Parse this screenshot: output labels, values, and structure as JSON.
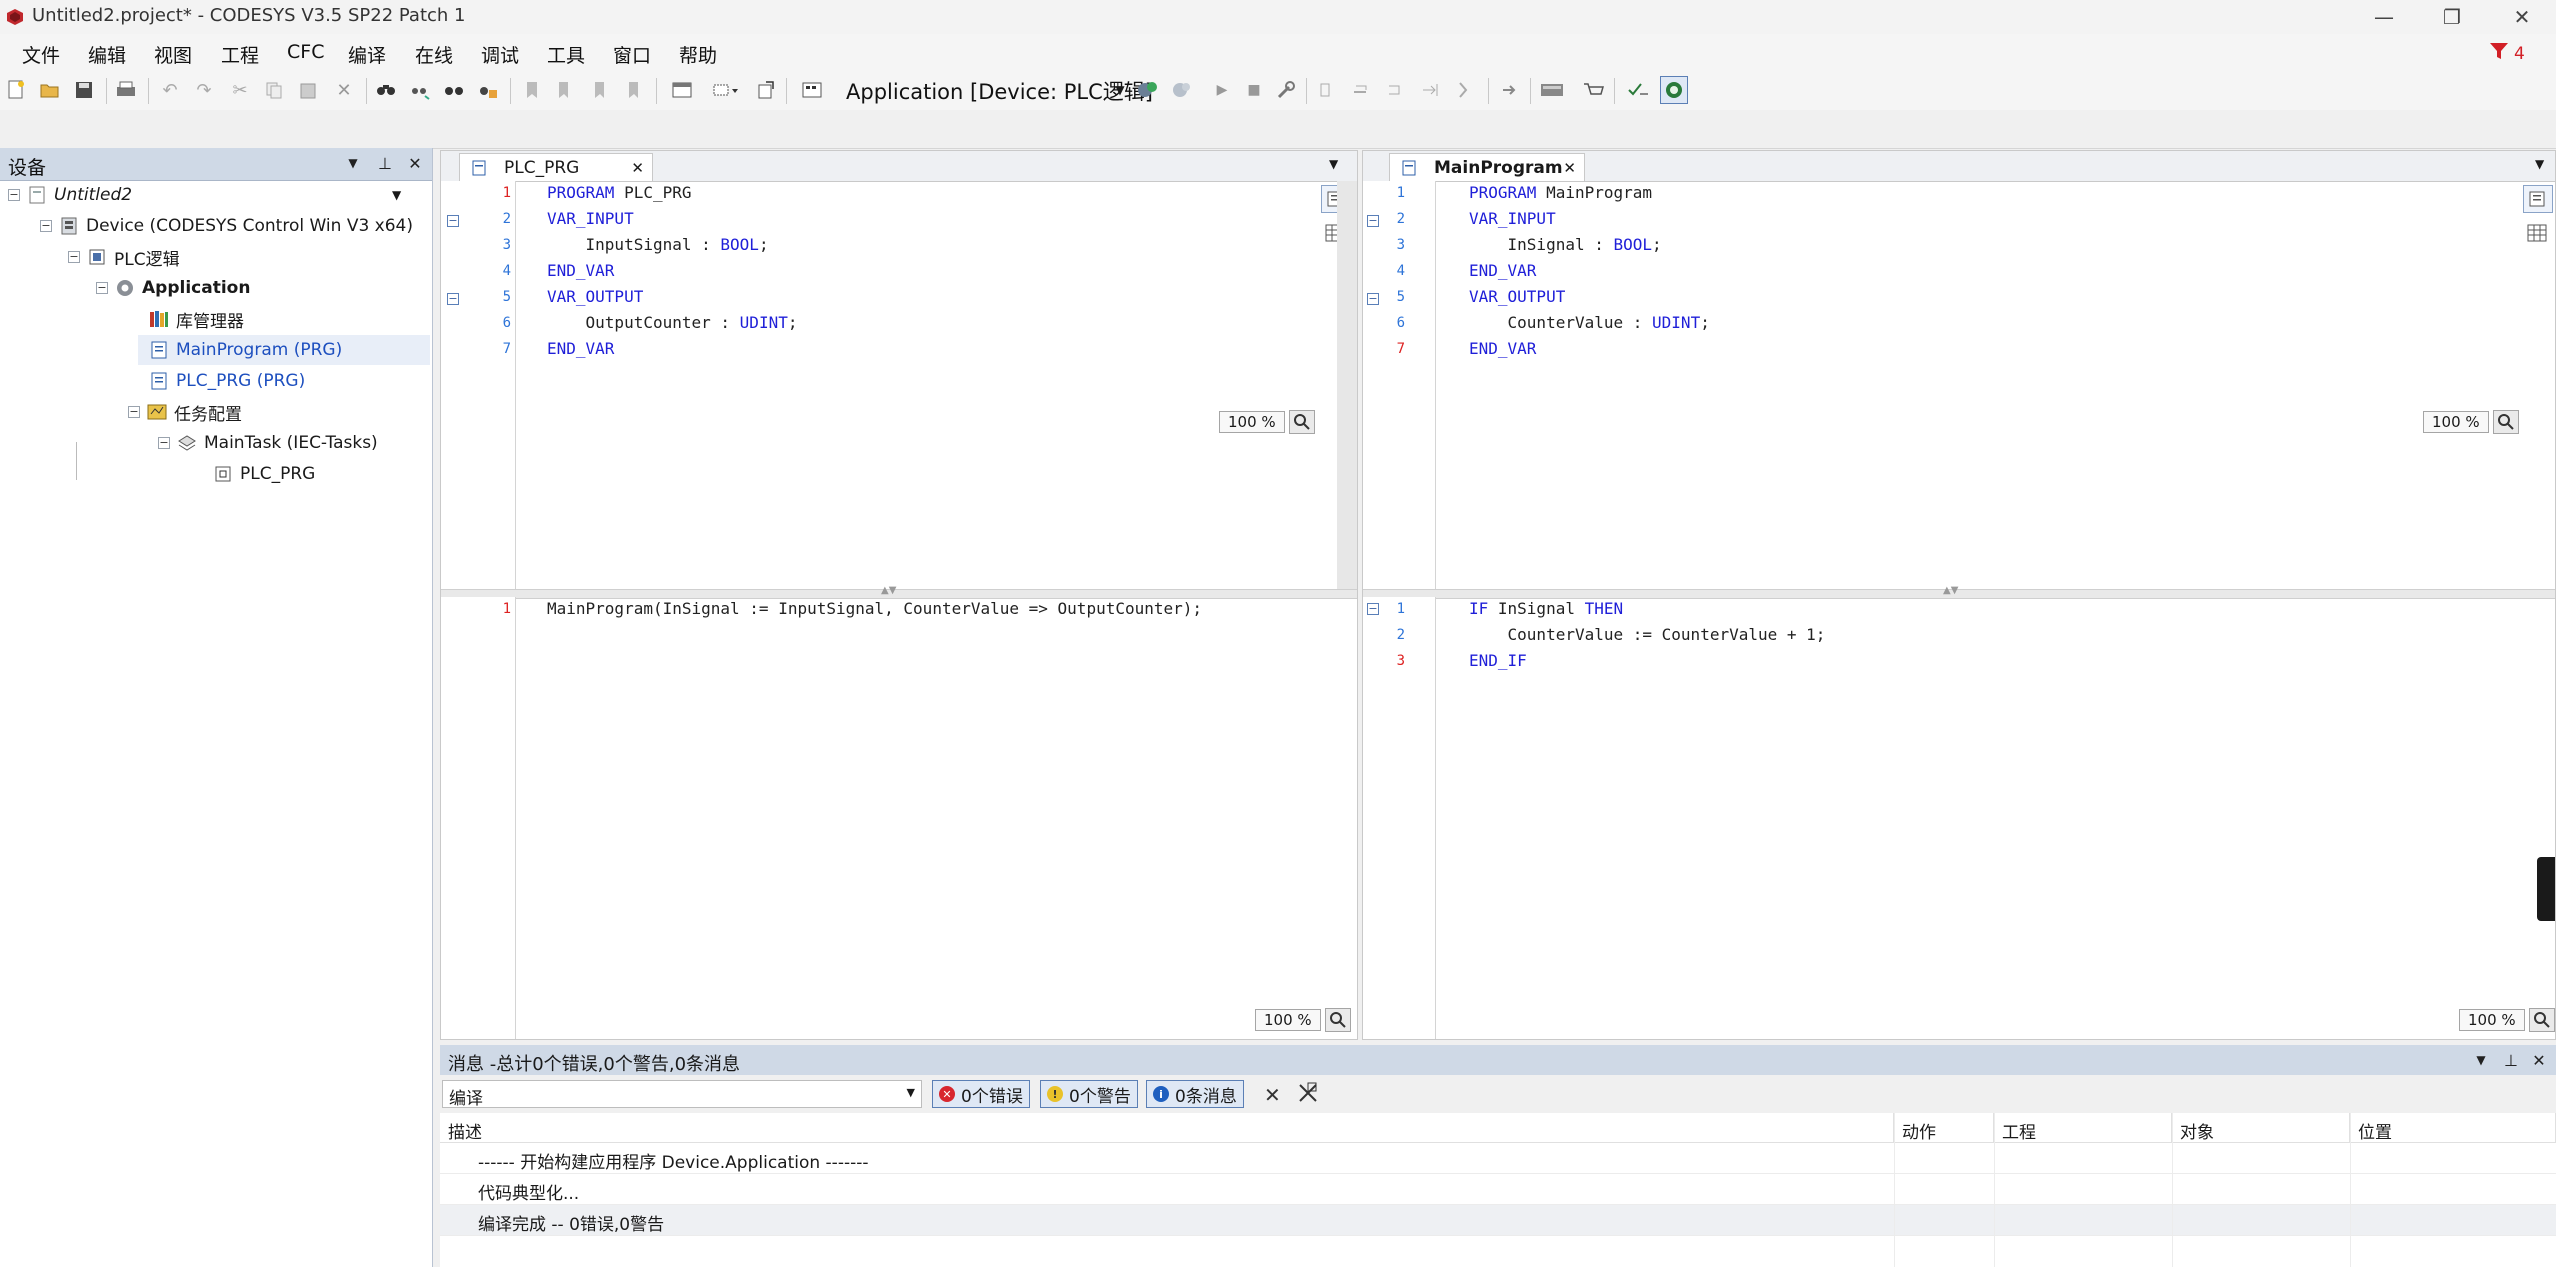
{
  "window": {
    "title": "Untitled2.project* - CODESYS V3.5 SP22 Patch 1",
    "minimize": "—",
    "restore": "❐",
    "close": "✕"
  },
  "menu": [
    "文件",
    "编辑",
    "视图",
    "工程",
    "CFC",
    "编译",
    "在线",
    "调试",
    "工具",
    "窗口",
    "帮助"
  ],
  "notification_count": "4",
  "toolbar": {
    "active_application": "Application [Device: PLC逻辑]"
  },
  "devices_panel": {
    "title": "设备",
    "tree": [
      {
        "label": "Untitled2",
        "level": 0,
        "icon": "project-icon"
      },
      {
        "label": "Device (CODESYS Control Win V3 x64)",
        "level": 1,
        "icon": "device-icon"
      },
      {
        "label": "PLC逻辑",
        "level": 2,
        "icon": "plc-logic-icon"
      },
      {
        "label": "Application",
        "level": 3,
        "icon": "application-gear-icon"
      },
      {
        "label": "库管理器",
        "level": 4,
        "icon": "library-manager-icon"
      },
      {
        "label": "MainProgram (PRG)",
        "level": 4,
        "icon": "program-icon"
      },
      {
        "label": "PLC_PRG (PRG)",
        "level": 4,
        "icon": "program-icon"
      },
      {
        "label": "任务配置",
        "level": 4,
        "icon": "task-config-icon"
      },
      {
        "label": "MainTask (IEC-Tasks)",
        "level": 5,
        "icon": "task-icon"
      },
      {
        "label": "PLC_PRG",
        "level": 6,
        "icon": "program-call-icon"
      }
    ]
  },
  "editor_left": {
    "tab": "PLC_PRG",
    "decl_lines": [
      "1",
      "2",
      "3",
      "4",
      "5",
      "6",
      "7"
    ],
    "impl_lines": [
      "1"
    ],
    "zoom_decl": "100 %",
    "zoom_impl": "100 %",
    "decl_code": [
      {
        "kw": "PROGRAM",
        "rest": " PLC_PRG"
      },
      {
        "kw": "VAR_INPUT",
        "rest": ""
      },
      {
        "indent": "    ",
        "name": "InputSignal",
        "sep": " : ",
        "kw": "BOOL",
        "rest": ";"
      },
      {
        "kw": "END_VAR",
        "rest": ""
      },
      {
        "kw": "VAR_OUTPUT",
        "rest": ""
      },
      {
        "indent": "    ",
        "name": "OutputCounter",
        "sep": " : ",
        "kw": "UDINT",
        "rest": ";"
      },
      {
        "kw": "END_VAR",
        "rest": ""
      }
    ],
    "impl_code": "MainProgram(InSignal := InputSignal, CounterValue => OutputCounter);"
  },
  "editor_right": {
    "tab": "MainProgram",
    "decl_lines": [
      "1",
      "2",
      "3",
      "4",
      "5",
      "6",
      "7"
    ],
    "impl_lines": [
      "1",
      "2",
      "3"
    ],
    "zoom_decl": "100 %",
    "zoom_impl": "100 %",
    "decl_code": [
      {
        "kw": "PROGRAM",
        "rest": " MainProgram"
      },
      {
        "kw": "VAR_INPUT",
        "rest": ""
      },
      {
        "indent": "    ",
        "name": "InSignal",
        "sep": " : ",
        "kw": "BOOL",
        "rest": ";"
      },
      {
        "kw": "END_VAR",
        "rest": ""
      },
      {
        "kw": "VAR_OUTPUT",
        "rest": ""
      },
      {
        "indent": "    ",
        "name": "CounterValue",
        "sep": " : ",
        "kw": "UDINT",
        "rest": ";"
      },
      {
        "kw": "END_VAR",
        "rest": ""
      }
    ],
    "impl_code": [
      {
        "kw1": "IF",
        "mid": " InSignal ",
        "kw2": "THEN"
      },
      {
        "indent": "    ",
        "text": "CounterValue := CounterValue + 1;"
      },
      {
        "kw1": "END_IF"
      }
    ]
  },
  "messages": {
    "header": "消息 -总计0个错误,0个警告,0条消息",
    "category": "编译",
    "errors": "0个错误",
    "warnings": "0个警告",
    "infos": "0条消息",
    "columns": [
      "描述",
      "动作",
      "工程",
      "对象",
      "位置"
    ],
    "rows": [
      "------ 开始构建应用程序 Device.Application -------",
      "代码典型化...",
      "编译完成 -- 0错误,0警告"
    ]
  }
}
